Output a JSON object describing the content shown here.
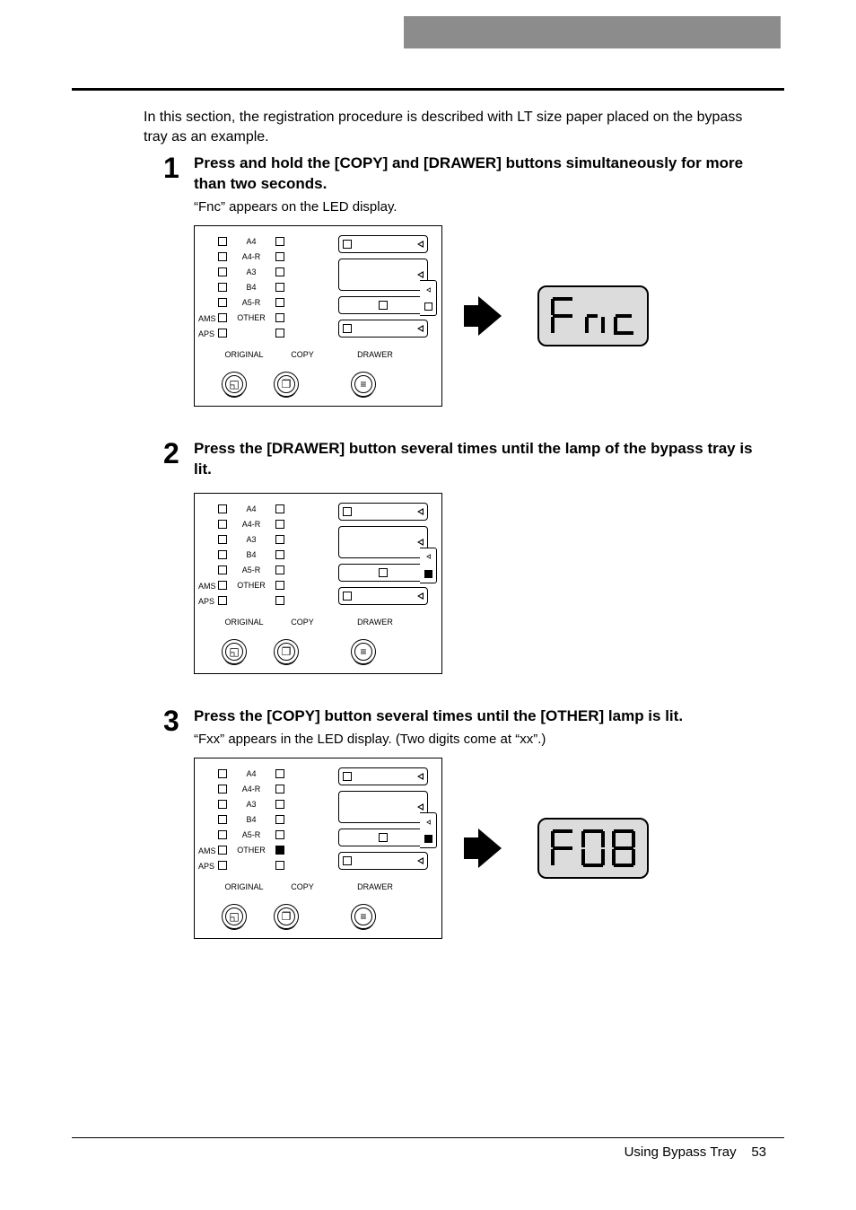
{
  "lead": "In this section, the registration procedure is described with LT size paper placed on the bypass tray as an example.",
  "steps": [
    {
      "num": "1",
      "title": "Press and hold the [COPY] and [DRAWER] buttons simultaneously for more than two seconds.",
      "sub": "“Fnc” appears on the LED display.",
      "led": "Fnc",
      "show_arrow": true
    },
    {
      "num": "2",
      "title": "Press the [DRAWER] button several times until the lamp of the bypass tray is lit.",
      "sub": "",
      "led": "",
      "show_arrow": false
    },
    {
      "num": "3",
      "title": "Press the [COPY] button several times until the [OTHER] lamp is lit.",
      "sub": "“Fxx” appears in the LED display. (Two digits come at “xx”.)",
      "led": "F08",
      "show_arrow": true
    }
  ],
  "panel": {
    "sizes": [
      "A4",
      "A4-R",
      "A3",
      "B4",
      "A5-R",
      "OTHER"
    ],
    "side_labels": [
      "AMS",
      "APS"
    ],
    "columns": [
      "ORIGINAL",
      "COPY",
      "DRAWER"
    ]
  },
  "footer": {
    "section": "Using Bypass Tray",
    "page": "53"
  }
}
